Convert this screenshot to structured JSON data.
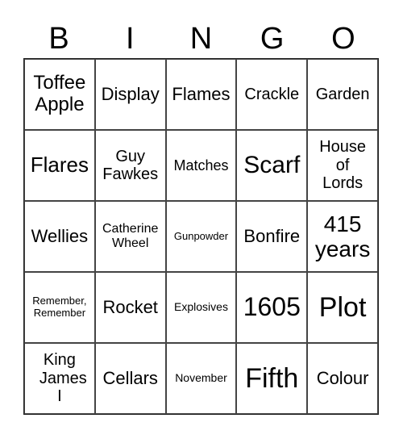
{
  "header": [
    "B",
    "I",
    "N",
    "G",
    "O"
  ],
  "cells": [
    "Toffee Apple",
    "Display",
    "Flames",
    "Crackle",
    "Garden",
    "Flares",
    "Guy Fawkes",
    "Matches",
    "Scarf",
    "House of Lords",
    "Wellies",
    "Catherine Wheel",
    "Gunpowder",
    "Bonfire",
    "415 years",
    "Remember, Remember",
    "Rocket",
    "Explosives",
    "1605",
    "Plot",
    "King James I",
    "Cellars",
    "November",
    "Fifth",
    "Colour"
  ]
}
